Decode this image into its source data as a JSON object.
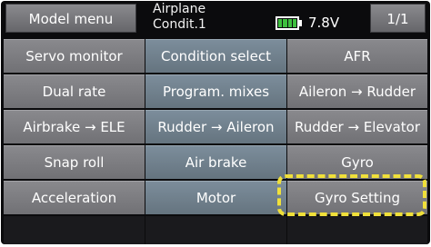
{
  "header": {
    "model_menu_label": "Model menu",
    "model_type": "Airplane",
    "condition": "Condit.1",
    "battery_icon": "battery-icon",
    "battery_level": 1.0,
    "battery_color": "#3fbf3f",
    "voltage": "7.8V",
    "page": "1/1"
  },
  "menu": {
    "items": [
      {
        "label": "Servo monitor"
      },
      {
        "label": "Condition select"
      },
      {
        "label": "AFR"
      },
      {
        "label": "Dual rate"
      },
      {
        "label": "Program. mixes"
      },
      {
        "label": "Aileron → Rudder"
      },
      {
        "label": "Airbrake → ELE"
      },
      {
        "label": "Rudder → Aileron"
      },
      {
        "label": "Rudder → Elevator"
      },
      {
        "label": "Snap roll"
      },
      {
        "label": "Air brake"
      },
      {
        "label": "Gyro"
      },
      {
        "label": "Acceleration"
      },
      {
        "label": "Motor"
      },
      {
        "label": "Gyro Setting"
      }
    ]
  },
  "highlight_color": "#f0e03a"
}
